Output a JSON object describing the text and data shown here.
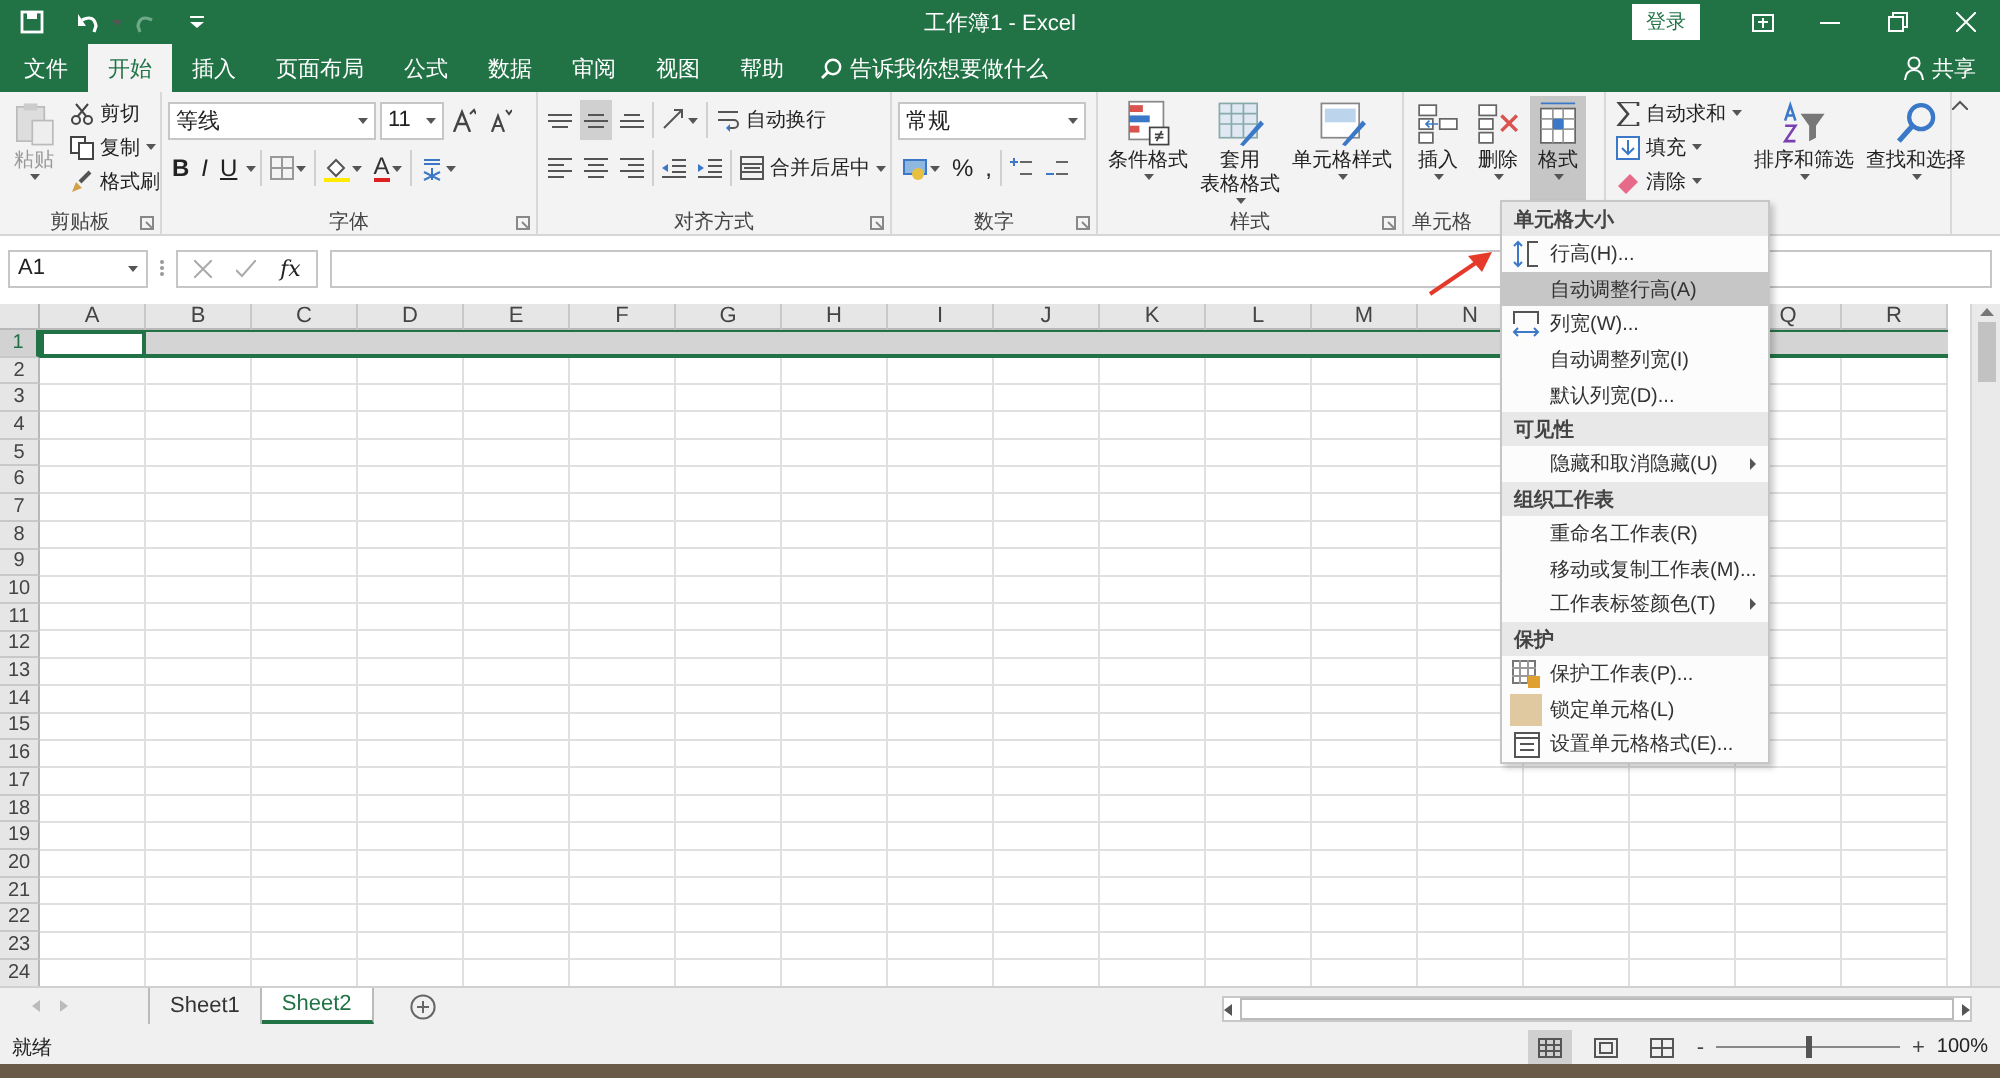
{
  "title_bar": {
    "title": "工作簿1  -  Excel",
    "sign_in": "登录"
  },
  "ribbon_tabs": [
    {
      "label": "文件",
      "selected": false
    },
    {
      "label": "开始",
      "selected": true
    },
    {
      "label": "插入",
      "selected": false
    },
    {
      "label": "页面布局",
      "selected": false
    },
    {
      "label": "公式",
      "selected": false
    },
    {
      "label": "数据",
      "selected": false
    },
    {
      "label": "审阅",
      "selected": false
    },
    {
      "label": "视图",
      "selected": false
    },
    {
      "label": "帮助",
      "selected": false
    }
  ],
  "tell_me": "告诉我你想要做什么",
  "share": "共享",
  "clipboard": {
    "paste": "粘贴",
    "cut": "剪切",
    "copy": "复制",
    "format_painter": "格式刷",
    "label": "剪贴板"
  },
  "font": {
    "name": "等线",
    "size": "11",
    "styles": [
      "B",
      "I",
      "U"
    ],
    "font_color": "A",
    "label": "字体"
  },
  "alignment": {
    "wrap": "自动换行",
    "merge": "合并后居中",
    "label": "对齐方式"
  },
  "number": {
    "format": "常规",
    "percent": "%",
    "comma": ",",
    "label": "数字"
  },
  "styles": {
    "buttons": [
      [
        "条件格式"
      ],
      [
        "套用",
        "表格格式"
      ],
      [
        "单元格样式"
      ]
    ],
    "label": "样式"
  },
  "cells": {
    "buttons": [
      {
        "label": "插入",
        "selected": false
      },
      {
        "label": "删除",
        "selected": false
      },
      {
        "label": "格式",
        "selected": true
      }
    ],
    "label": "单元格"
  },
  "editing": {
    "autosum": "自动求和",
    "fill": "填充",
    "clear": "清除",
    "sort": "排序和筛选",
    "find": "查找和选择"
  },
  "formula_bar": {
    "name_box": "A1",
    "function_label": "fx"
  },
  "columns": [
    {
      "label": "A"
    },
    {
      "label": "B"
    },
    {
      "label": "C"
    },
    {
      "label": "D"
    },
    {
      "label": "E"
    },
    {
      "label": "F"
    },
    {
      "label": "G"
    },
    {
      "label": "H"
    },
    {
      "label": "I"
    },
    {
      "label": "J"
    },
    {
      "label": "K"
    },
    {
      "label": "L"
    },
    {
      "label": "M"
    },
    {
      "label": "N"
    },
    {},
    {},
    {
      "label": "Q"
    },
    {
      "label": "R"
    }
  ],
  "rows": [
    {
      "label": "1",
      "selected": true
    },
    {
      "label": "2",
      "selected": false
    },
    {
      "label": "3",
      "selected": false
    },
    {
      "label": "4",
      "selected": false
    },
    {
      "label": "5",
      "selected": false
    },
    {
      "label": "6",
      "selected": false
    },
    {
      "label": "7",
      "selected": false
    },
    {
      "label": "8",
      "selected": false
    },
    {
      "label": "9",
      "selected": false
    },
    {
      "label": "10",
      "selected": false
    },
    {
      "label": "11",
      "selected": false
    },
    {
      "label": "12",
      "selected": false
    },
    {
      "label": "13",
      "selected": false
    },
    {
      "label": "14",
      "selected": false
    },
    {
      "label": "15",
      "selected": false
    },
    {
      "label": "16",
      "selected": false
    },
    {
      "label": "17",
      "selected": false
    },
    {
      "label": "18",
      "selected": false
    },
    {
      "label": "19",
      "selected": false
    },
    {
      "label": "20",
      "selected": false
    },
    {
      "label": "21",
      "selected": false
    },
    {
      "label": "22",
      "selected": false
    },
    {
      "label": "23",
      "selected": false
    },
    {
      "label": "24",
      "selected": false
    }
  ],
  "format_menu": [
    {
      "kind": "header",
      "label": "单元格大小"
    },
    {
      "kind": "height",
      "label": "行高(H)...",
      "selected": false
    },
    {
      "kind": "plain",
      "label": "自动调整行高(A)",
      "selected": true
    },
    {
      "kind": "width",
      "label": "列宽(W)...",
      "selected": false
    },
    {
      "kind": "plain",
      "label": "自动调整列宽(I)",
      "selected": false
    },
    {
      "kind": "plain",
      "label": "默认列宽(D)...",
      "selected": false
    },
    {
      "kind": "header",
      "label": "可见性"
    },
    {
      "kind": "submenu",
      "label": "隐藏和取消隐藏(U)",
      "selected": false
    },
    {
      "kind": "header",
      "label": "组织工作表"
    },
    {
      "kind": "plain",
      "label": "重命名工作表(R)",
      "selected": false
    },
    {
      "kind": "plain",
      "label": "移动或复制工作表(M)...",
      "selected": false
    },
    {
      "kind": "submenu",
      "label": "工作表标签颜色(T)",
      "selected": false
    },
    {
      "kind": "header",
      "label": "保护"
    },
    {
      "kind": "protect",
      "label": "保护工作表(P)...",
      "selected": false
    },
    {
      "kind": "lock",
      "label": "锁定单元格(L)",
      "selected": false
    },
    {
      "kind": "format",
      "label": "设置单元格格式(E)...",
      "selected": false
    }
  ],
  "sheet_tabs": [
    {
      "label": "Sheet1",
      "selected": false
    },
    {
      "label": "Sheet2",
      "selected": true
    }
  ],
  "status_bar": {
    "status": "就绪",
    "zoom_out": "-",
    "zoom_in": "+",
    "zoom": "100%",
    "level": 0.5
  }
}
